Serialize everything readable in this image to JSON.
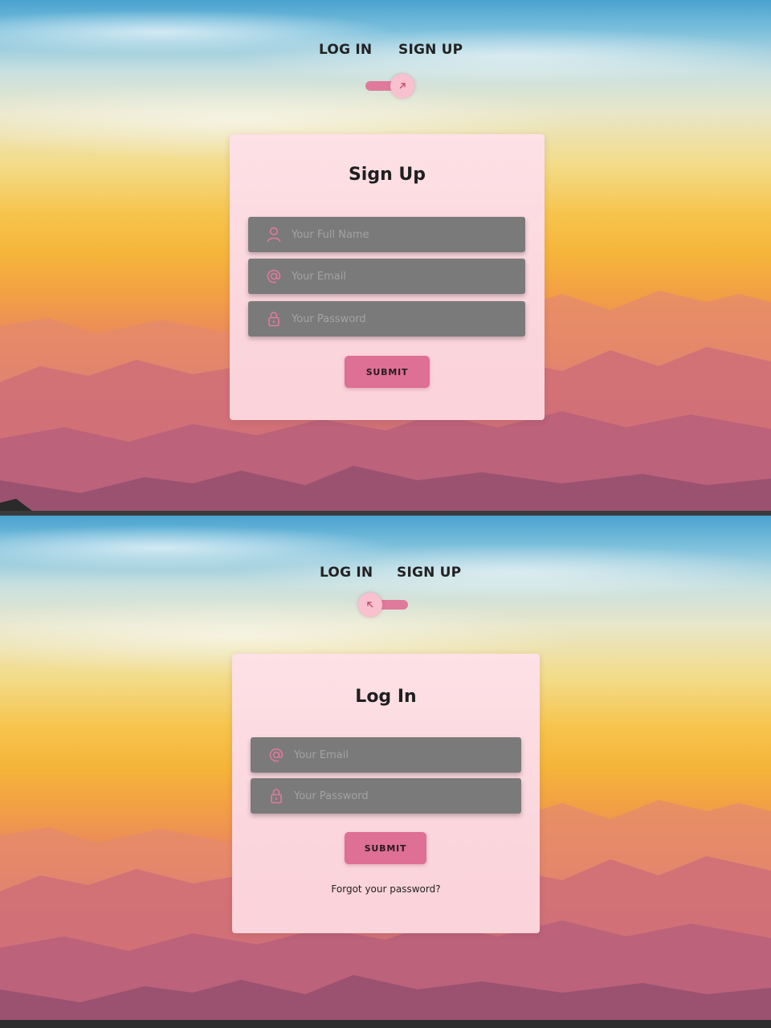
{
  "colors": {
    "accent": "#de6f95",
    "card_bg": "#fbd6dd",
    "field_bg": "#7a7a7a",
    "icon": "#e07a9c"
  },
  "signup_view": {
    "nav": {
      "login_tab": "LOG IN",
      "signup_tab": "SIGN UP"
    },
    "toggle": {
      "state": "signup",
      "knob_icon": "arrow-up-right-icon"
    },
    "title": "Sign Up",
    "fields": [
      {
        "icon": "user-icon",
        "placeholder": "Your Full Name"
      },
      {
        "icon": "at-sign-icon",
        "placeholder": "Your Email"
      },
      {
        "icon": "lock-icon",
        "placeholder": "Your Password"
      }
    ],
    "submit_label": "SUBMIT"
  },
  "login_view": {
    "nav": {
      "login_tab": "LOG IN",
      "signup_tab": "SIGN UP"
    },
    "toggle": {
      "state": "login",
      "knob_icon": "arrow-up-left-icon"
    },
    "title": "Log In",
    "fields": [
      {
        "icon": "at-sign-icon",
        "placeholder": "Your Email"
      },
      {
        "icon": "lock-icon",
        "placeholder": "Your Password"
      }
    ],
    "submit_label": "SUBMIT",
    "forgot_link": "Forgot your password?"
  }
}
